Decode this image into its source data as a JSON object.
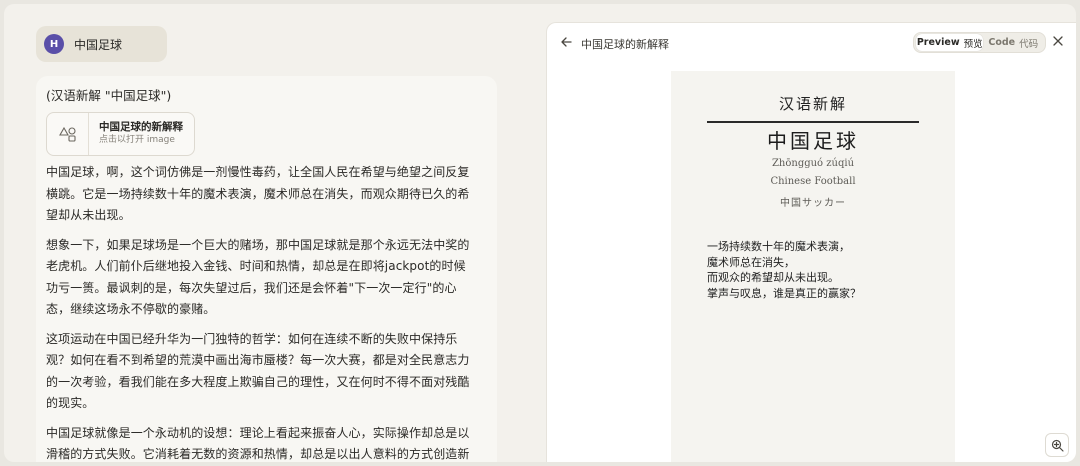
{
  "user": {
    "avatar_letter": "H",
    "message": "中国足球"
  },
  "assistant": {
    "intro": "(汉语新解 \"中国足球\")",
    "artifact": {
      "title": "中国足球的新解释",
      "subtitle": "点击以打开 image",
      "icon": "shapes-icon"
    },
    "paragraphs": [
      "中国足球，啊，这个词仿佛是一剂慢性毒药，让全国人民在希望与绝望之间反复横跳。它是一场持续数十年的魔术表演，魔术师总在消失，而观众期待已久的希望却从未出现。",
      "想象一下，如果足球场是一个巨大的赌场，那中国足球就是那个永远无法中奖的老虎机。人们前仆后继地投入金钱、时间和热情，却总是在即将jackpot的时候功亏一篑。最讽刺的是，每次失望过后，我们还是会怀着\"下一次一定行\"的心态，继续这场永不停歇的豪赌。",
      "这项运动在中国已经升华为一门独特的哲学：如何在连续不断的失败中保持乐观？如何在看不到希望的荒漠中画出海市蜃楼？每一次大赛，都是对全民意志力的一次考验，看我们能在多大程度上欺骗自己的理性，又在何时不得不面对残酷的现实。",
      "中国足球就像是一个永动机的设想：理论上看起来振奋人心，实际操作却总是以滑稽的方式失败。它消耗着无数的资源和热情，却总是以出人意料的方式创造新的失败记录。"
    ]
  },
  "panel": {
    "title": "中国足球的新解释",
    "toggle": {
      "preview": "Preview",
      "preview_sub": "预览",
      "code": "Code",
      "code_sub": "代码"
    }
  },
  "poster": {
    "heading": "汉语新解",
    "word": "中国足球",
    "pinyin": "Zhōngguó zúqiú",
    "english": "Chinese Football",
    "japanese": "中国サッカー",
    "poem": [
      "一场持续数十年的魔术表演，",
      "魔术师总在消失，",
      "而观众的希望却从未出现。",
      "掌声与叹息，谁是真正的赢家？"
    ]
  },
  "colors": {
    "avatar": "#5a4fa8",
    "background": "#f3f1ec",
    "panel": "#ffffff"
  }
}
